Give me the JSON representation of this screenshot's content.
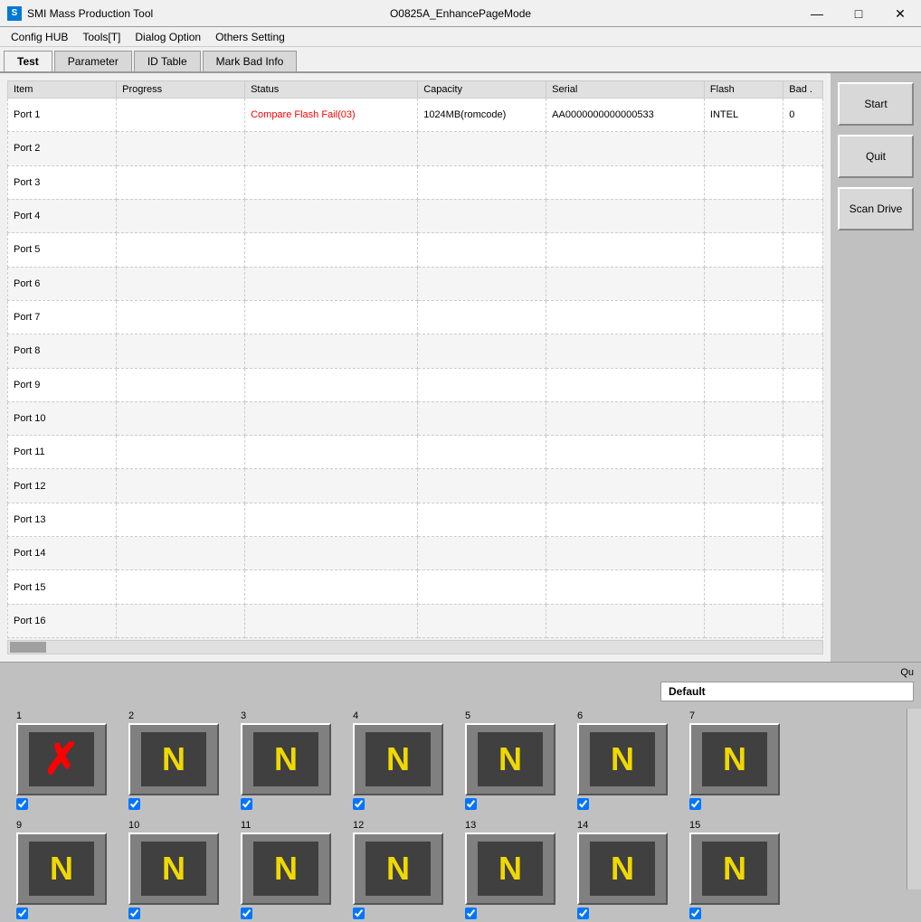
{
  "titlebar": {
    "icon_label": "S",
    "app_title": "SMI Mass Production Tool",
    "center_title": "O0825A_EnhancePageMode",
    "minimize": "—",
    "maximize": "□",
    "close": "✕"
  },
  "menubar": {
    "items": [
      "Config HUB",
      "Tools[T]",
      "Dialog Option",
      "Others Setting"
    ]
  },
  "tabs": [
    {
      "label": "Test",
      "active": true
    },
    {
      "label": "Parameter",
      "active": false
    },
    {
      "label": "ID Table",
      "active": false
    },
    {
      "label": "Mark Bad Info",
      "active": false
    }
  ],
  "table": {
    "headers": [
      "Item",
      "Progress",
      "Status",
      "Capacity",
      "Serial",
      "Flash",
      "Bad ."
    ],
    "rows": [
      {
        "item": "Port 1",
        "progress": "",
        "status": "Compare Flash Fail(03)",
        "status_type": "fail",
        "capacity": "1024MB(romcode)",
        "serial": "AA0000000000000533",
        "flash": "INTEL",
        "bad": "0"
      },
      {
        "item": "Port 2",
        "progress": "",
        "status": "",
        "status_type": "normal",
        "capacity": "",
        "serial": "",
        "flash": "",
        "bad": ""
      },
      {
        "item": "Port 3",
        "progress": "",
        "status": "",
        "status_type": "normal",
        "capacity": "",
        "serial": "",
        "flash": "",
        "bad": ""
      },
      {
        "item": "Port 4",
        "progress": "",
        "status": "",
        "status_type": "normal",
        "capacity": "",
        "serial": "",
        "flash": "",
        "bad": ""
      },
      {
        "item": "Port 5",
        "progress": "",
        "status": "",
        "status_type": "normal",
        "capacity": "",
        "serial": "",
        "flash": "",
        "bad": ""
      },
      {
        "item": "Port 6",
        "progress": "",
        "status": "",
        "status_type": "normal",
        "capacity": "",
        "serial": "",
        "flash": "",
        "bad": ""
      },
      {
        "item": "Port 7",
        "progress": "",
        "status": "",
        "status_type": "normal",
        "capacity": "",
        "serial": "",
        "flash": "",
        "bad": ""
      },
      {
        "item": "Port 8",
        "progress": "",
        "status": "",
        "status_type": "normal",
        "capacity": "",
        "serial": "",
        "flash": "",
        "bad": ""
      },
      {
        "item": "Port 9",
        "progress": "",
        "status": "",
        "status_type": "normal",
        "capacity": "",
        "serial": "",
        "flash": "",
        "bad": ""
      },
      {
        "item": "Port 10",
        "progress": "",
        "status": "",
        "status_type": "normal",
        "capacity": "",
        "serial": "",
        "flash": "",
        "bad": ""
      },
      {
        "item": "Port 11",
        "progress": "",
        "status": "",
        "status_type": "normal",
        "capacity": "",
        "serial": "",
        "flash": "",
        "bad": ""
      },
      {
        "item": "Port 12",
        "progress": "",
        "status": "",
        "status_type": "normal",
        "capacity": "",
        "serial": "",
        "flash": "",
        "bad": ""
      },
      {
        "item": "Port 13",
        "progress": "",
        "status": "",
        "status_type": "normal",
        "capacity": "",
        "serial": "",
        "flash": "",
        "bad": ""
      },
      {
        "item": "Port 14",
        "progress": "",
        "status": "",
        "status_type": "normal",
        "capacity": "",
        "serial": "",
        "flash": "",
        "bad": ""
      },
      {
        "item": "Port 15",
        "progress": "",
        "status": "",
        "status_type": "normal",
        "capacity": "",
        "serial": "",
        "flash": "",
        "bad": ""
      },
      {
        "item": "Port 16",
        "progress": "",
        "status": "",
        "status_type": "normal",
        "capacity": "",
        "serial": "",
        "flash": "",
        "bad": ""
      }
    ]
  },
  "buttons": {
    "start": "Start",
    "quit": "Quit",
    "scan_drive": "Scan Drive"
  },
  "bottom_bar": {
    "quit_label": "Qu"
  },
  "port_section": {
    "label": "Default",
    "ports_row1": [
      {
        "num": "1",
        "type": "x",
        "checked": true
      },
      {
        "num": "2",
        "type": "n",
        "checked": true
      },
      {
        "num": "3",
        "type": "n",
        "checked": true
      },
      {
        "num": "4",
        "type": "n",
        "checked": true
      },
      {
        "num": "5",
        "type": "n",
        "checked": true
      },
      {
        "num": "6",
        "type": "n",
        "checked": true
      },
      {
        "num": "7",
        "type": "n",
        "checked": true
      }
    ],
    "ports_row2": [
      {
        "num": "9",
        "type": "n",
        "checked": true
      },
      {
        "num": "10",
        "type": "n",
        "checked": true
      },
      {
        "num": "11",
        "type": "n",
        "checked": true
      },
      {
        "num": "12",
        "type": "n",
        "checked": true
      },
      {
        "num": "13",
        "type": "n",
        "checked": true
      },
      {
        "num": "14",
        "type": "n",
        "checked": true
      },
      {
        "num": "15",
        "type": "n",
        "checked": true
      }
    ]
  }
}
